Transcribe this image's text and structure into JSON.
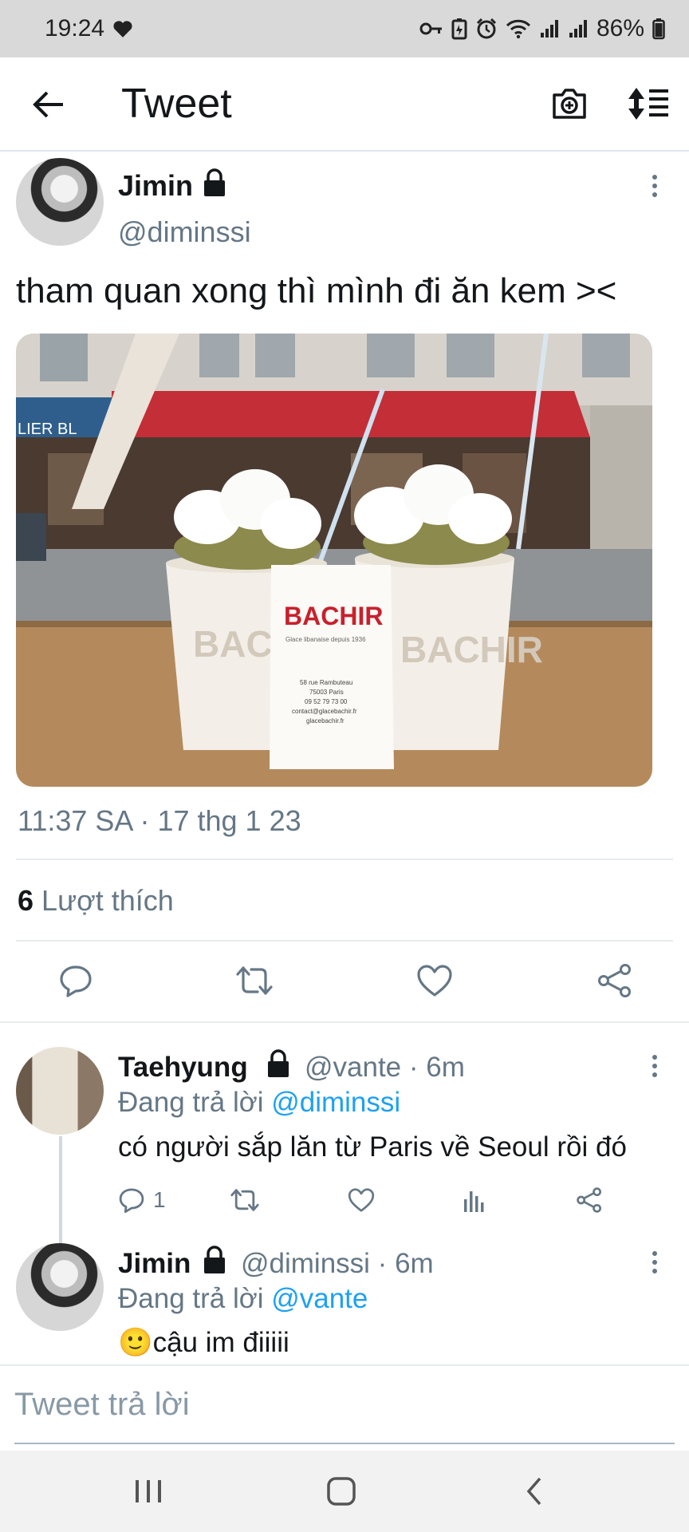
{
  "status_bar": {
    "time": "19:24",
    "battery": "86%",
    "icons": [
      "heart-icon",
      "key-icon",
      "battery-saver-icon",
      "alarm-icon",
      "wifi-icon",
      "signal-icon",
      "signal-icon",
      "battery-icon"
    ]
  },
  "app_bar": {
    "title": "Tweet",
    "icons": [
      "back-arrow-icon",
      "camera-icon",
      "sort-icon"
    ]
  },
  "tweet": {
    "author_name": "Jimin",
    "author_handle": "@diminssi",
    "text": "tham quan xong thì mình đi ăn kem ><",
    "photo": {
      "shop_card_brand": "BACHIR",
      "shop_card_tagline": "Glace libanaise depuis 1936",
      "shop_card_lines": [
        "58 rue Rambuteau",
        "75003 Paris",
        "09 52 79 73 00",
        "contact@glacebachir.fr",
        "glacebachir.fr"
      ],
      "cup_brand_left": "BACHI",
      "cup_brand_right": "BACHIR",
      "awning_text": "LIER BL"
    },
    "timestamp": "11:37 SA · 17 thg 1 23",
    "likes_count": "6",
    "likes_label": "Lượt thích",
    "actions": [
      "reply-icon",
      "retweet-icon",
      "like-icon",
      "share-icon"
    ]
  },
  "replies": [
    {
      "author_name": "Taehyung",
      "author_handle": "@vante",
      "time": "6m",
      "replying_label": "Đang trả lời",
      "replying_to": "@diminssi",
      "text": "có người sắp lăn từ Paris về Seoul rồi đó",
      "reply_count": "1",
      "actions": [
        "reply-icon",
        "retweet-icon",
        "like-icon",
        "analytics-icon",
        "share-icon"
      ]
    },
    {
      "author_name": "Jimin",
      "author_handle": "@diminssi",
      "time": "6m",
      "replying_label": "Đang trả lời",
      "replying_to": "@vante",
      "emoji": "🙂",
      "text": "cậu im điiiii"
    }
  ],
  "composer": {
    "placeholder": "Tweet trả lời"
  },
  "nav_bar": {
    "icons": [
      "recent-apps-icon",
      "home-icon",
      "back-icon"
    ]
  },
  "colors": {
    "accent": "#1da1f2",
    "secondary_text": "#657786",
    "status_bar_bg": "#d9d9d9"
  }
}
